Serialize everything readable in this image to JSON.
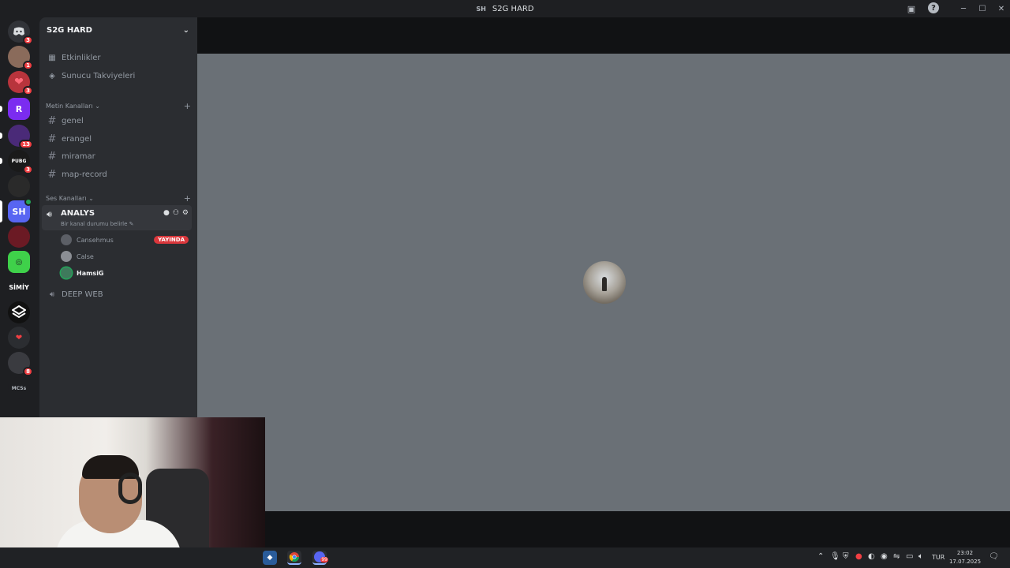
{
  "window": {
    "badge": "SH",
    "title": "S2G HARD",
    "minimize": "─",
    "maximize": "☐",
    "close": "✕"
  },
  "rail": {
    "discord_badge": "3",
    "servers": [
      {
        "label": "",
        "badge": "1"
      },
      {
        "label": "",
        "badge": "3"
      },
      {
        "label": "R",
        "badge": ""
      },
      {
        "label": "",
        "badge": "13"
      },
      {
        "label": "PUBG",
        "badge": "3"
      },
      {
        "label": "",
        "badge": ""
      },
      {
        "label": "SH",
        "badge": ""
      },
      {
        "label": "",
        "badge": ""
      },
      {
        "label": "",
        "badge": ""
      },
      {
        "label": "SİMİY",
        "badge": ""
      },
      {
        "label": "",
        "badge": ""
      },
      {
        "label": "",
        "badge": ""
      },
      {
        "label": "",
        "badge": "8"
      },
      {
        "label": "MCSs",
        "badge": ""
      }
    ]
  },
  "sidebar": {
    "server_name": "S2G HARD",
    "top_links": [
      {
        "label": "Etkinlikler",
        "icon": "calendar-icon"
      },
      {
        "label": "Sunucu Takviyeleri",
        "icon": "boost-icon"
      }
    ],
    "text_category": "Metin Kanalları",
    "text_channels": [
      "genel",
      "erangel",
      "miramar",
      "map-record"
    ],
    "voice_category": "Ses Kanalları",
    "active_voice": {
      "name": "ANALYS",
      "status": "Bir kanal durumu belirle"
    },
    "members": [
      {
        "name": "Cansehmus",
        "live": "YAYINDA"
      },
      {
        "name": "Calse",
        "live": ""
      },
      {
        "name": "HamsiG",
        "live": ""
      }
    ],
    "other_voice": "DEEP WEB"
  },
  "taskbar": {
    "lang": "TUR",
    "time": "23:02",
    "date": "17.07.2025",
    "discord_badge": "99"
  },
  "colors": {
    "accent": "#5865f2",
    "live_red": "#da373c",
    "stage_bg": "#6a7076"
  }
}
